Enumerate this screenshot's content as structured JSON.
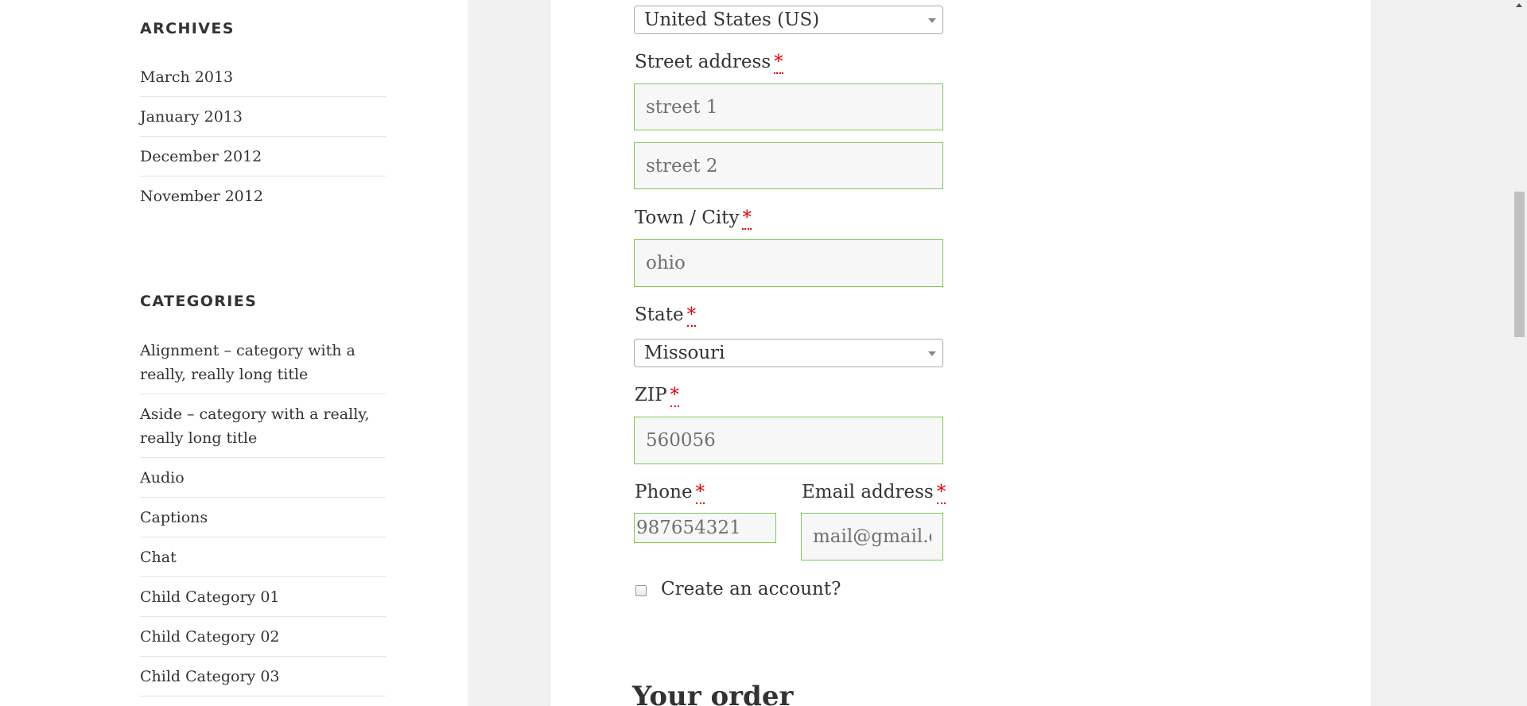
{
  "sidebar": {
    "archives": {
      "title": "ARCHIVES",
      "items": [
        "March 2013",
        "January 2013",
        "December 2012",
        "November 2012"
      ]
    },
    "categories": {
      "title": "CATEGORIES",
      "items": [
        "Alignment – category with a really, really long title",
        "Aside – category with a really, really long title",
        "Audio",
        "Captions",
        "Chat",
        "Child Category 01",
        "Child Category 02",
        "Child Category 03"
      ]
    }
  },
  "form": {
    "required_mark": "*",
    "country": {
      "value": "United States (US)"
    },
    "street": {
      "label": "Street address",
      "line1": "street 1",
      "line2": "street 2"
    },
    "city": {
      "label": "Town / City",
      "value": "ohio"
    },
    "state": {
      "label": "State",
      "value": "Missouri"
    },
    "zip": {
      "label": "ZIP",
      "value": "560056"
    },
    "phone": {
      "label": "Phone",
      "value": "987654321"
    },
    "email": {
      "label": "Email address",
      "value": "mail@gmail.com"
    },
    "create_account": {
      "label": "Create an account?"
    }
  },
  "order": {
    "heading": "Your order"
  },
  "colors": {
    "valid_border": "#7ec855",
    "required": "#e00000",
    "background": "#f1f1f1"
  }
}
